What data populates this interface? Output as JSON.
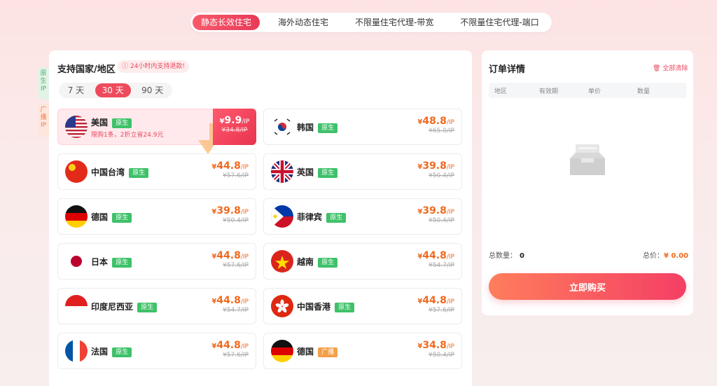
{
  "tabs": [
    {
      "label": "静态长效住宅",
      "active": true
    },
    {
      "label": "海外动态住宅",
      "active": false
    },
    {
      "label": "不限量住宅代理-带宽",
      "active": false
    },
    {
      "label": "不限量住宅代理-端口",
      "active": false
    }
  ],
  "side_tabs": {
    "native": "原生IP",
    "broadcast": "广播IP"
  },
  "left": {
    "title": "支持国家/地区",
    "refund_note": "24小时内支持退款!",
    "periods": [
      {
        "label": "7 天",
        "active": false
      },
      {
        "label": "30 天",
        "active": true
      },
      {
        "label": "90 天",
        "active": false
      }
    ]
  },
  "countries": [
    {
      "name": "美国",
      "tag": "原生",
      "price": "9.9",
      "old": "¥34.8/IP",
      "promo": "限购1条，2折立省24.9元",
      "highlight": true
    },
    {
      "name": "韩国",
      "tag": "原生",
      "price": "48.8",
      "old": "¥65.0/IP"
    },
    {
      "name": "中国台湾",
      "tag": "原生",
      "price": "44.8",
      "old": "¥57.6/IP"
    },
    {
      "name": "英国",
      "tag": "原生",
      "price": "39.8",
      "old": "¥50.4/IP"
    },
    {
      "name": "德国",
      "tag": "原生",
      "price": "39.8",
      "old": "¥50.4/IP"
    },
    {
      "name": "菲律宾",
      "tag": "原生",
      "price": "39.8",
      "old": "¥50.4/IP"
    },
    {
      "name": "日本",
      "tag": "原生",
      "price": "44.8",
      "old": "¥57.6/IP"
    },
    {
      "name": "越南",
      "tag": "原生",
      "price": "44.8",
      "old": "¥54.7/IP"
    },
    {
      "name": "印度尼西亚",
      "tag": "原生",
      "price": "44.8",
      "old": "¥54.7/IP"
    },
    {
      "name": "中国香港",
      "tag": "原生",
      "price": "44.8",
      "old": "¥57.6/IP"
    },
    {
      "name": "法国",
      "tag": "原生",
      "price": "44.8",
      "old": "¥57.6/IP"
    },
    {
      "name": "德国",
      "tag": "广播",
      "price": "34.8",
      "old": "¥50.4/IP"
    }
  ],
  "price_symbol": "¥",
  "price_unit": "/IP",
  "order": {
    "title": "订单详情",
    "clear_label": "全部清除",
    "columns": [
      "地区",
      "有效期",
      "单价",
      "数量"
    ],
    "total_qty_label": "总数量：",
    "total_qty": "0",
    "total_price_label": "总价：",
    "total_price": "¥ 0.00",
    "buy_label": "立即购买"
  },
  "colors": {
    "accent": "#ef4a5c",
    "price": "#f06a20",
    "native_badge": "#3fc169",
    "broadcast_badge": "#f4a04a"
  }
}
